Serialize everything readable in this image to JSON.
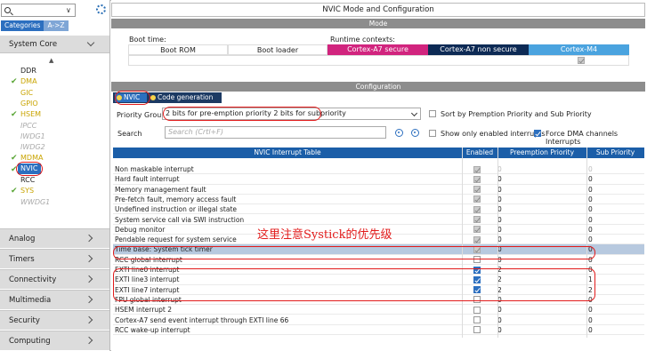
{
  "left": {
    "tabs": [
      "Categories",
      "A->Z"
    ],
    "system_core_label": "System Core",
    "peripherals": [
      {
        "label": "DDR",
        "style": "normal",
        "checked": false
      },
      {
        "label": "DMA",
        "style": "green",
        "checked": true
      },
      {
        "label": "GIC",
        "style": "green",
        "checked": false
      },
      {
        "label": "GPIO",
        "style": "green",
        "checked": false
      },
      {
        "label": "HSEM",
        "style": "green",
        "checked": true
      },
      {
        "label": "IPCC",
        "style": "grey",
        "checked": false
      },
      {
        "label": "IWDG1",
        "style": "grey",
        "checked": false
      },
      {
        "label": "IWDG2",
        "style": "grey",
        "checked": false
      },
      {
        "label": "MDMA",
        "style": "green",
        "checked": true
      },
      {
        "label": "NVIC",
        "style": "selected",
        "checked": true
      },
      {
        "label": "RCC",
        "style": "normal",
        "checked": false
      },
      {
        "label": "SYS",
        "style": "green",
        "checked": true
      },
      {
        "label": "WWDG1",
        "style": "grey",
        "checked": false
      }
    ],
    "categories": [
      "Analog",
      "Timers",
      "Connectivity",
      "Multimedia",
      "Security",
      "Computing"
    ]
  },
  "right": {
    "title": "NVIC Mode and Configuration",
    "mode_label": "Mode",
    "boot_time_label": "Boot time:",
    "runtime_label": "Runtime contexts:",
    "boot_rom": "Boot ROM",
    "boot_loader": "Boot loader",
    "cores": [
      "Cortex-A7 secure",
      "Cortex-A7 non secure",
      "Cortex-M4"
    ],
    "config_label": "Configuration",
    "tabs": [
      "NVIC",
      "Code generation"
    ],
    "priority_group_label": "Priority Group",
    "priority_group_value": "2 bits for pre-emption priority 2 bits for subpriority",
    "sort_label": "Sort by Premption Priority and Sub Priority",
    "search_label": "Search",
    "search_placeholder": "Search (Crtl+F)",
    "show_enabled_label": "Show only enabled interrupts",
    "force_dma_label": "Force DMA channels Interrupts",
    "table_headers": [
      "NVIC Interrupt Table",
      "Enabled",
      "Preemption Priority",
      "Sub Priority"
    ],
    "rows": [
      {
        "name": "Non maskable interrupt",
        "enabled": "fixed",
        "pre": "0",
        "sub": "0",
        "dim": true
      },
      {
        "name": "Hard fault interrupt",
        "enabled": "fixed",
        "pre": "0",
        "sub": "0",
        "dim": false
      },
      {
        "name": "Memory management fault",
        "enabled": "fixed",
        "pre": "0",
        "sub": "0",
        "dim": false
      },
      {
        "name": "Pre-fetch fault, memory access fault",
        "enabled": "fixed",
        "pre": "0",
        "sub": "0",
        "dim": false
      },
      {
        "name": "Undefined instruction or illegal state",
        "enabled": "fixed",
        "pre": "0",
        "sub": "0",
        "dim": false
      },
      {
        "name": "System service call via SWI instruction",
        "enabled": "fixed",
        "pre": "0",
        "sub": "0",
        "dim": false
      },
      {
        "name": "Debug monitor",
        "enabled": "fixed",
        "pre": "0",
        "sub": "0",
        "dim": false
      },
      {
        "name": "Pendable request for system service",
        "enabled": "fixed",
        "pre": "0",
        "sub": "0",
        "dim": false
      },
      {
        "name": "Time base: System tick timer",
        "enabled": "fixed",
        "pre": "0",
        "sub": "0",
        "dim": false,
        "highlight": true
      },
      {
        "name": "RCC global interrupt",
        "enabled": "off",
        "pre": "0",
        "sub": "0",
        "dim": false
      },
      {
        "name": "EXTI line0 interrupt",
        "enabled": "on",
        "pre": "2",
        "sub": "0",
        "dim": false
      },
      {
        "name": "EXTI line3 interrupt",
        "enabled": "on",
        "pre": "2",
        "sub": "1",
        "dim": false
      },
      {
        "name": "EXTI line7 interrupt",
        "enabled": "on",
        "pre": "2",
        "sub": "2",
        "dim": false
      },
      {
        "name": "FPU global interrupt",
        "enabled": "off",
        "pre": "0",
        "sub": "0",
        "dim": false
      },
      {
        "name": "HSEM interrupt 2",
        "enabled": "off",
        "pre": "0",
        "sub": "0",
        "dim": false
      },
      {
        "name": "Cortex-A7 send event interrupt through EXTI line 66",
        "enabled": "off",
        "pre": "0",
        "sub": "0",
        "dim": false
      },
      {
        "name": "RCC wake-up interrupt",
        "enabled": "off",
        "pre": "0",
        "sub": "0",
        "dim": false
      }
    ],
    "annotation": "这里注意Systick的优先级"
  },
  "colors": {
    "accent": "#2c6fbf",
    "core_secure": "#d1247e",
    "core_nonsecure": "#0d2a55",
    "core_m4": "#4aa3df",
    "annotation": "#e21b1b"
  }
}
